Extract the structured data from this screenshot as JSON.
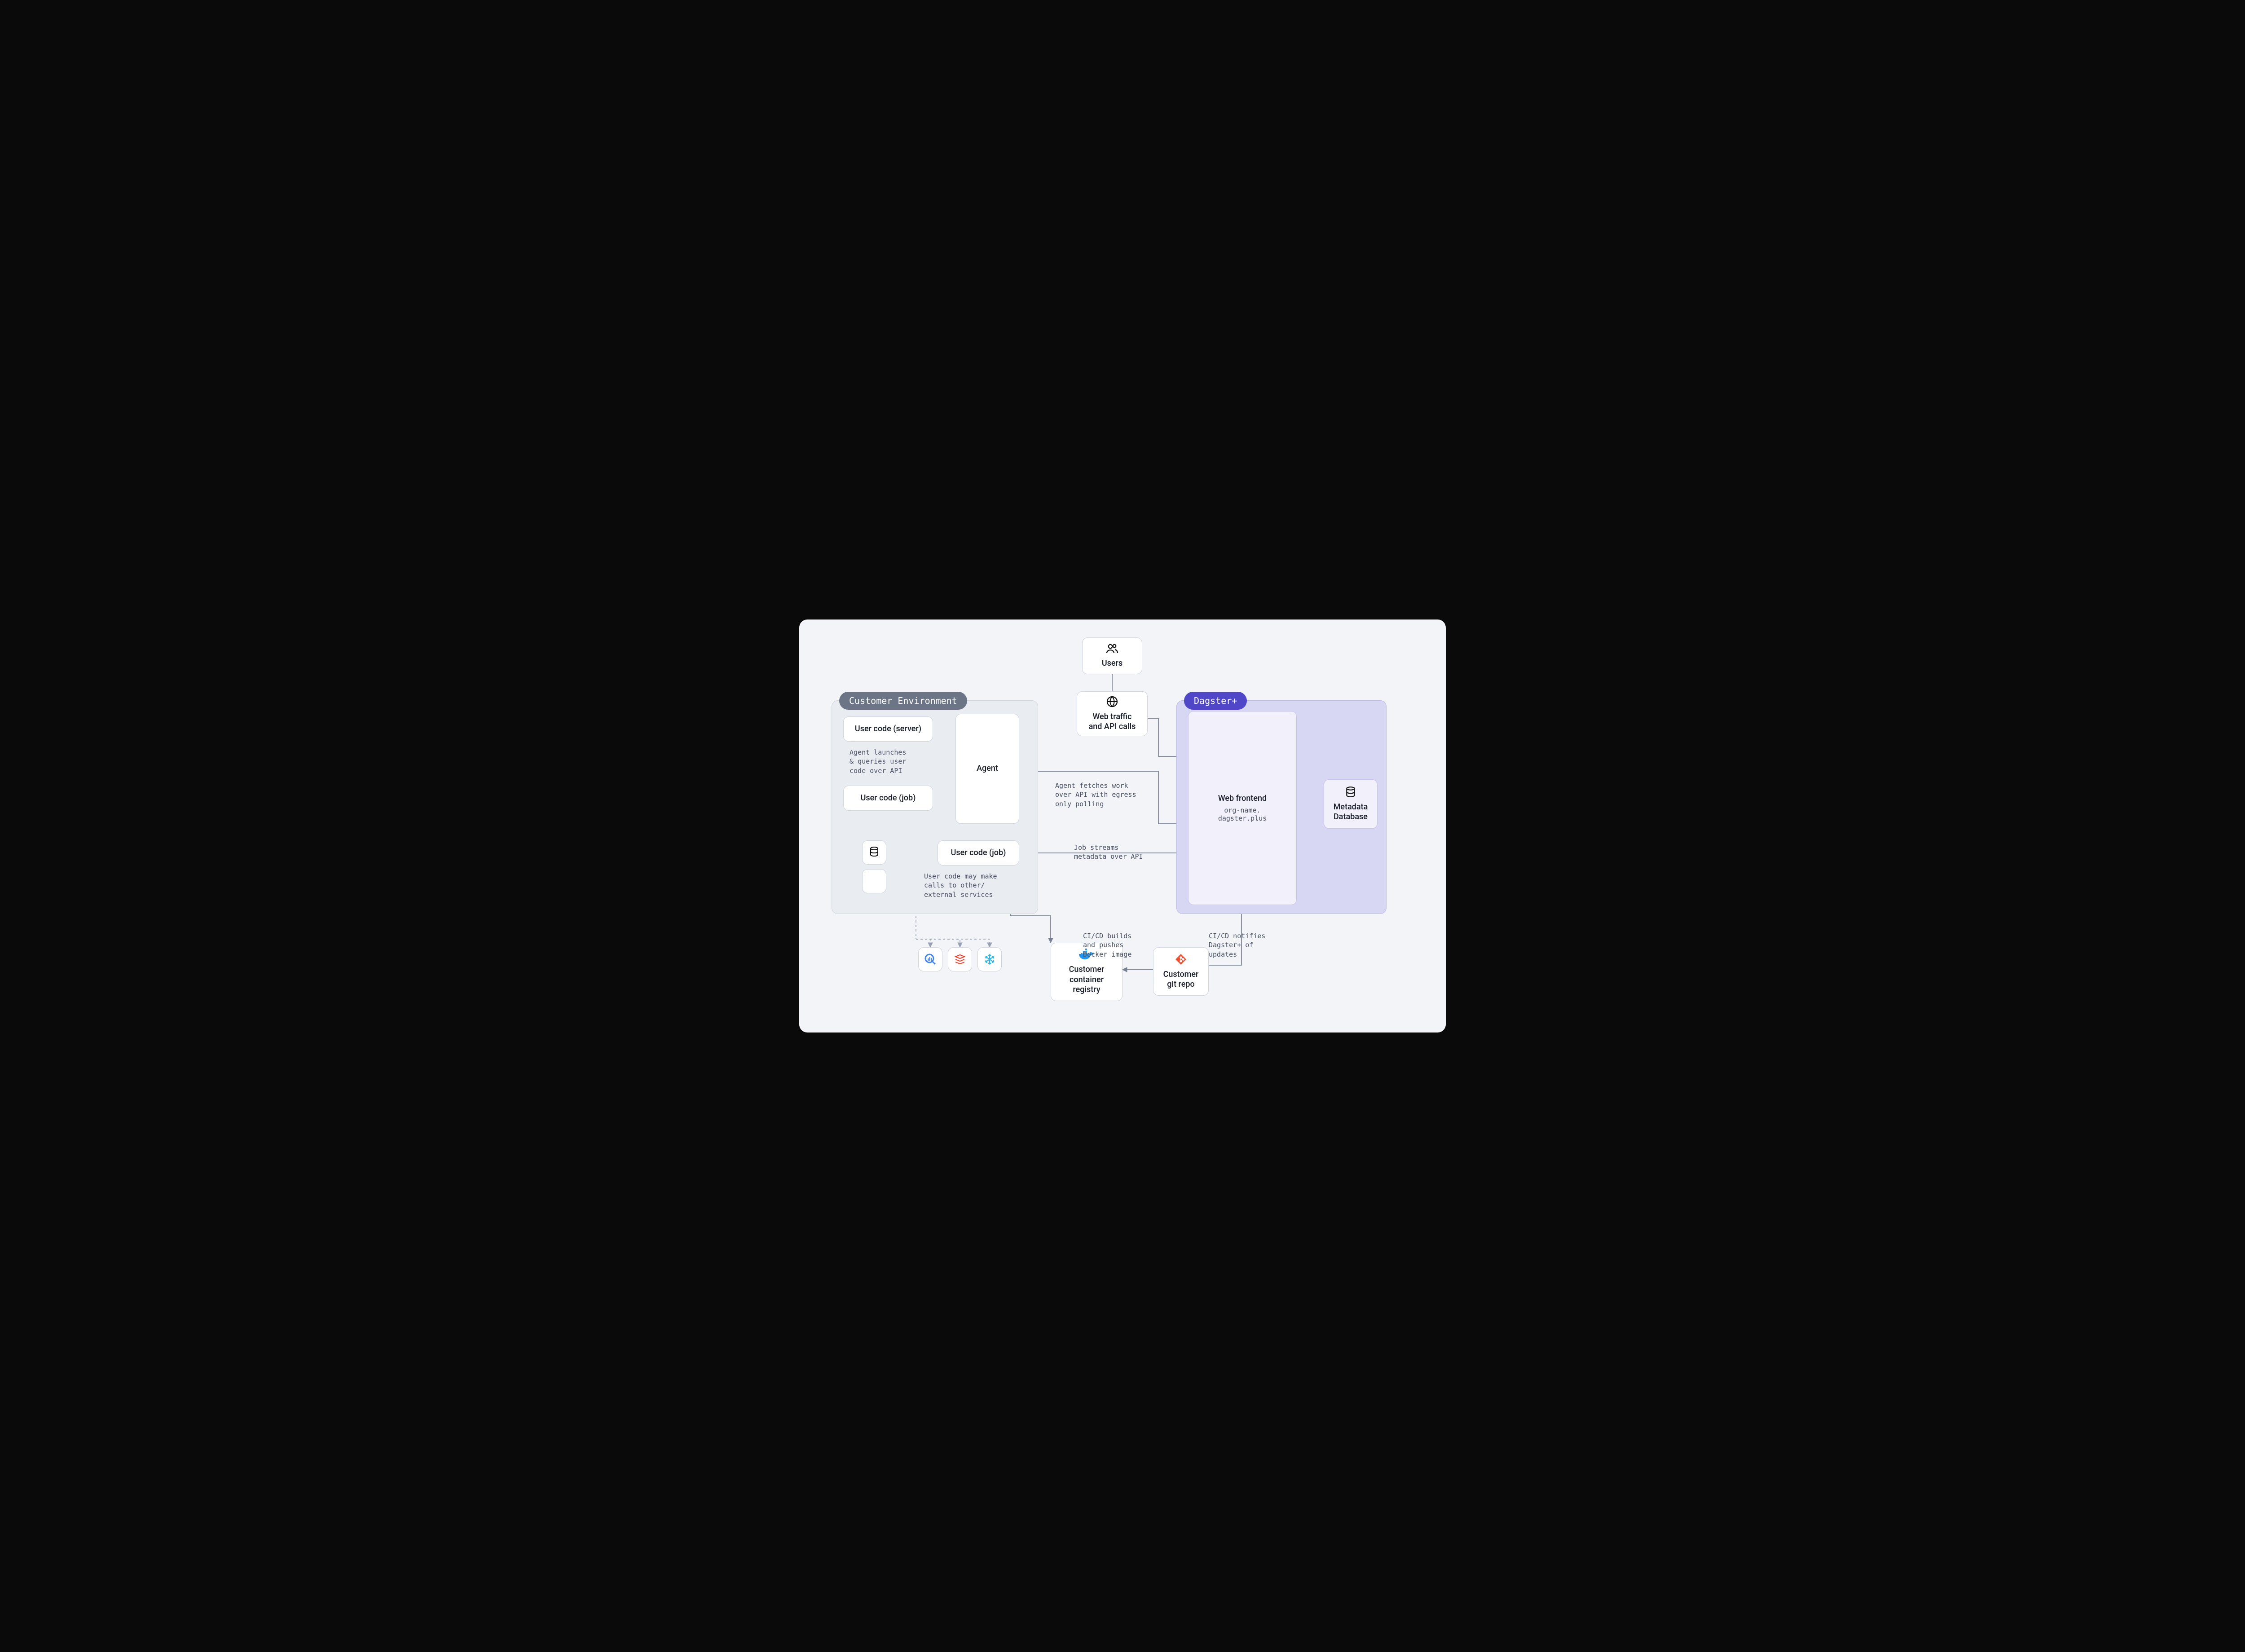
{
  "regions": {
    "customer": {
      "label": "Customer Environment"
    },
    "dagster": {
      "label": "Dagster+"
    }
  },
  "nodes": {
    "users": {
      "title": "Users"
    },
    "web_traffic": {
      "title": "Web traffic\nand API calls"
    },
    "agent": {
      "title": "Agent"
    },
    "user_code_server": {
      "title": "User code (server)"
    },
    "user_code_job_a": {
      "title": "User code (job)"
    },
    "user_code_job_b": {
      "title": "User code (job)"
    },
    "web_frontend": {
      "title": "Web frontend",
      "subtitle": "org-name.\ndagster.plus"
    },
    "metadata_db": {
      "title": "Metadata\nDatabase"
    },
    "container_reg": {
      "title": "Customer\ncontainer\nregistry"
    },
    "git_repo": {
      "title": "Customer\ngit repo"
    }
  },
  "edge_labels": {
    "agent_launches": "Agent launches\n& queries user\ncode over API",
    "agent_fetches": "Agent fetches work\nover API with egress\nonly polling",
    "job_streams": "Job streams\nmetadata over API",
    "user_code_calls": "User code may make\ncalls to other/\nexternal services",
    "cicd_builds": "CI/CD builds\nand pushes\nDocker image",
    "cicd_notifies": "CI/CD notifies\nDagster+ of\nupdates"
  },
  "service_icons": [
    "bigquery",
    "databricks",
    "snowflake"
  ]
}
